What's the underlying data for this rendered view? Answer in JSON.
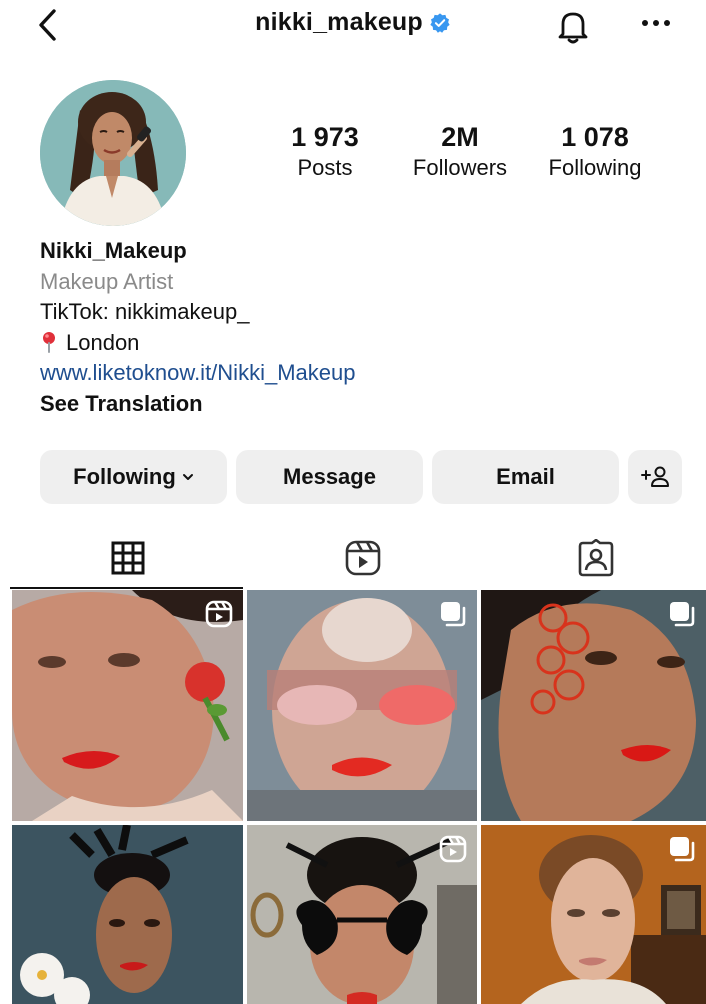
{
  "header": {
    "username": "nikki_makeup",
    "verified": true
  },
  "icons": {
    "back": "back-chevron-icon",
    "verified": "verified-badge-icon",
    "notifications": "bell-icon",
    "more": "more-horizontal-icon",
    "location": "location-pin-icon",
    "dropdown": "chevron-down-icon",
    "add_user": "add-person-icon",
    "tab_grid": "grid-icon",
    "tab_reels": "reels-icon",
    "tab_tagged": "tagged-person-icon"
  },
  "stats": {
    "posts": {
      "value": "1 973",
      "label": "Posts"
    },
    "followers": {
      "value": "2M",
      "label": "Followers"
    },
    "following": {
      "value": "1 078",
      "label": "Following"
    }
  },
  "bio": {
    "name": "Nikki_Makeup",
    "category": "Makeup Artist",
    "line1": "TikTok: nikkimakeup_",
    "location": "London",
    "link": "www.liketoknow.it/Nikki_Makeup",
    "see_translation": "See Translation"
  },
  "actions": {
    "following": "Following",
    "message": "Message",
    "email": "Email"
  },
  "tabs": [
    {
      "name": "posts",
      "icon": "grid-icon",
      "active": true
    },
    {
      "name": "reels",
      "icon": "reels-icon",
      "active": false
    },
    {
      "name": "tagged",
      "icon": "tagged-person-icon",
      "active": false
    }
  ],
  "posts": [
    {
      "type": "reel",
      "badge_icon": "reel-badge-icon"
    },
    {
      "type": "carousel",
      "badge_icon": "carousel-badge-icon"
    },
    {
      "type": "carousel",
      "badge_icon": "carousel-badge-icon"
    },
    {
      "type": "image",
      "badge_icon": ""
    },
    {
      "type": "reel",
      "badge_icon": "reel-badge-icon"
    },
    {
      "type": "carousel",
      "badge_icon": "carousel-badge-icon"
    }
  ],
  "colors": {
    "text": "#111111",
    "category": "#8a8a8a",
    "link": "#1f4e8f",
    "verified": "#3897f0",
    "button_bg": "#efefef"
  }
}
